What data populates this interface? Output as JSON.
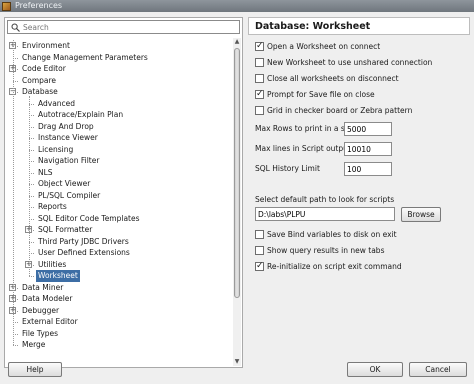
{
  "window": {
    "title": "Preferences"
  },
  "search": {
    "placeholder": "Search"
  },
  "tree": [
    {
      "label": "Environment",
      "level": 0,
      "expander": "+"
    },
    {
      "label": "Change Management Parameters",
      "level": 0,
      "expander": ""
    },
    {
      "label": "Code Editor",
      "level": 0,
      "expander": "+"
    },
    {
      "label": "Compare",
      "level": 0,
      "expander": ""
    },
    {
      "label": "Database",
      "level": 0,
      "expander": "−"
    },
    {
      "label": "Advanced",
      "level": 1,
      "expander": ""
    },
    {
      "label": "Autotrace/Explain Plan",
      "level": 1,
      "expander": ""
    },
    {
      "label": "Drag And Drop",
      "level": 1,
      "expander": ""
    },
    {
      "label": "Instance Viewer",
      "level": 1,
      "expander": ""
    },
    {
      "label": "Licensing",
      "level": 1,
      "expander": ""
    },
    {
      "label": "Navigation Filter",
      "level": 1,
      "expander": ""
    },
    {
      "label": "NLS",
      "level": 1,
      "expander": ""
    },
    {
      "label": "Object Viewer",
      "level": 1,
      "expander": ""
    },
    {
      "label": "PL/SQL Compiler",
      "level": 1,
      "expander": ""
    },
    {
      "label": "Reports",
      "level": 1,
      "expander": ""
    },
    {
      "label": "SQL Editor Code Templates",
      "level": 1,
      "expander": ""
    },
    {
      "label": "SQL Formatter",
      "level": 1,
      "expander": "+"
    },
    {
      "label": "Third Party JDBC Drivers",
      "level": 1,
      "expander": ""
    },
    {
      "label": "User Defined Extensions",
      "level": 1,
      "expander": ""
    },
    {
      "label": "Utilities",
      "level": 1,
      "expander": "+"
    },
    {
      "label": "Worksheet",
      "level": 1,
      "expander": "",
      "selected": true
    },
    {
      "label": "Data Miner",
      "level": 0,
      "expander": "+"
    },
    {
      "label": "Data Modeler",
      "level": 0,
      "expander": "+"
    },
    {
      "label": "Debugger",
      "level": 0,
      "expander": "+"
    },
    {
      "label": "External Editor",
      "level": 0,
      "expander": ""
    },
    {
      "label": "File Types",
      "level": 0,
      "expander": ""
    },
    {
      "label": "Merge",
      "level": 0,
      "expander": ""
    }
  ],
  "panel": {
    "title": "Database: Worksheet",
    "options": [
      {
        "label": "Open a Worksheet on connect",
        "checked": true
      },
      {
        "label": "New Worksheet to use unshared connection",
        "checked": false
      },
      {
        "label": "Close all worksheets on disconnect",
        "checked": false
      },
      {
        "label": "Prompt for Save file on close",
        "checked": true
      },
      {
        "label": "Grid in checker board or Zebra pattern",
        "checked": false
      }
    ],
    "fields": [
      {
        "label": "Max Rows to print in a script",
        "value": "5000"
      },
      {
        "label": "Max lines in Script output",
        "value": "10010"
      },
      {
        "label": "SQL History Limit",
        "value": "100"
      }
    ],
    "path_label": "Select default path to look for scripts",
    "path_value": "D:\\labs\\PLPU",
    "browse_label": "Browse",
    "options2": [
      {
        "label": "Save Bind variables to disk on exit",
        "checked": false
      },
      {
        "label": "Show query results in new tabs",
        "checked": false
      },
      {
        "label": "Re-initialize on script exit command",
        "checked": true
      }
    ]
  },
  "buttons": {
    "help": "Help",
    "ok": "OK",
    "cancel": "Cancel"
  }
}
